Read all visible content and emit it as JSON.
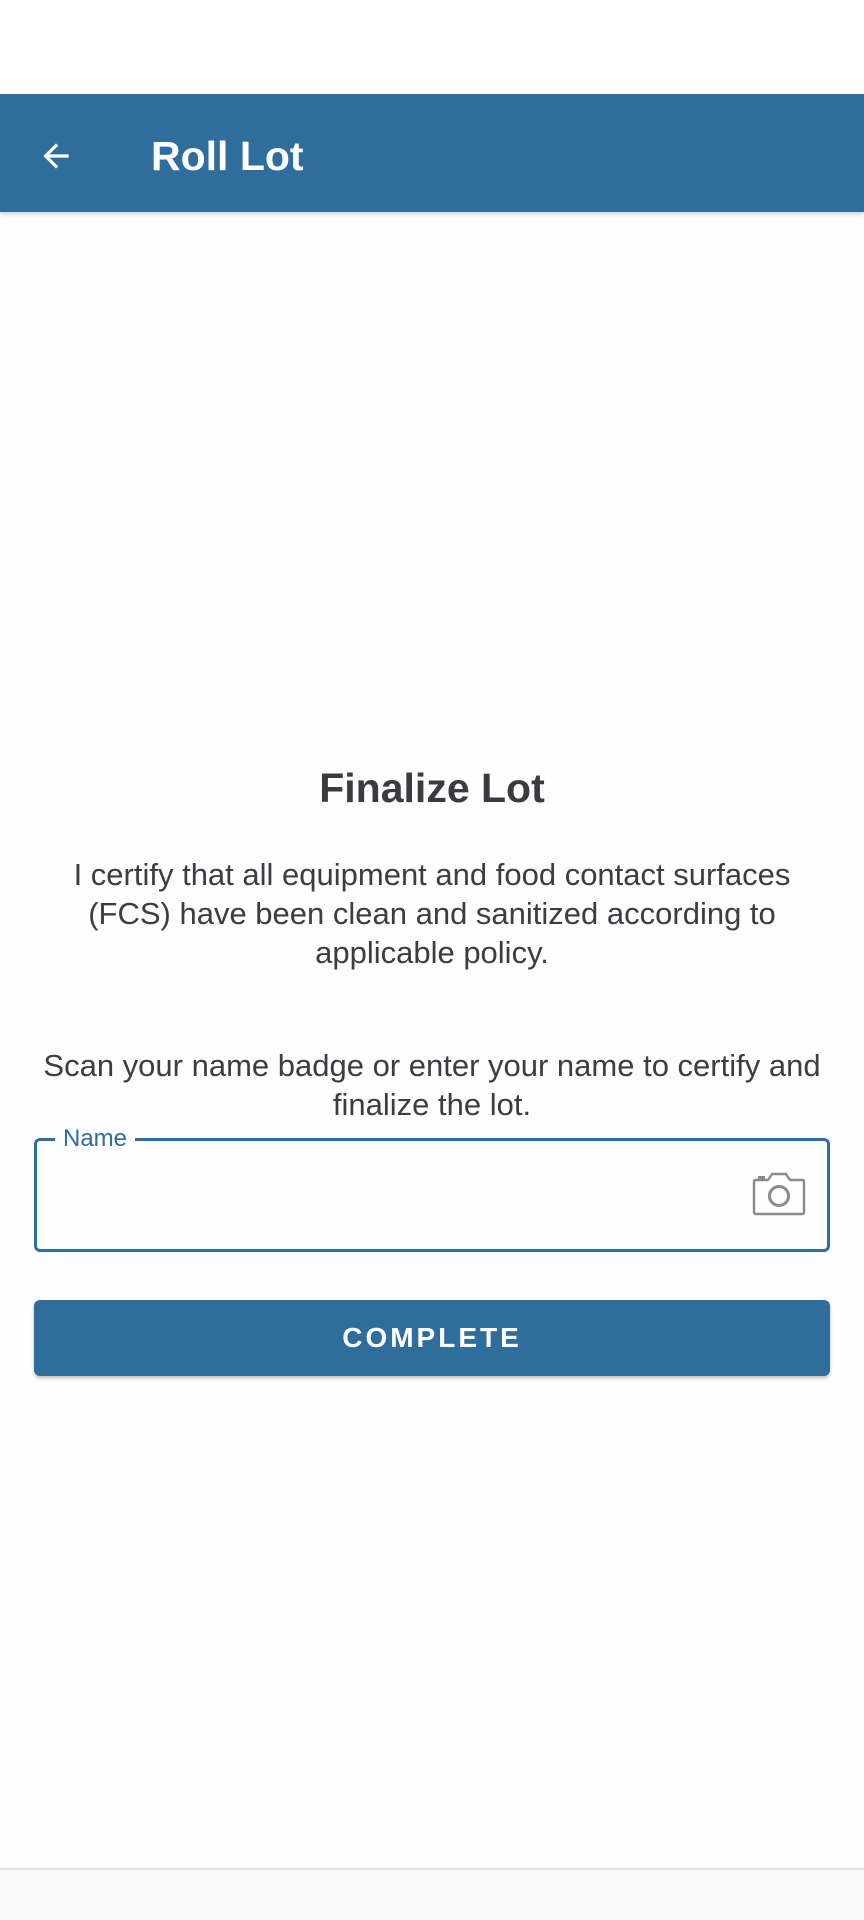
{
  "app_bar": {
    "title": "Roll Lot",
    "back_icon": "arrow-left-icon",
    "background_color": "#2f6d9c"
  },
  "finalize": {
    "title": "Finalize Lot",
    "certification_text": "I certify that all equipment and food contact surfaces (FCS) have been clean and sanitized according to applicable policy.",
    "instruction_text": "Scan your name badge or enter your name to certify and finalize the lot."
  },
  "name_field": {
    "label": "Name",
    "value": "",
    "scan_icon": "camera-icon"
  },
  "complete_button": {
    "label": "COMPLETE"
  },
  "colors": {
    "accent": "#2f6d9c",
    "text": "#3c3c43",
    "background": "#fdfdfd"
  }
}
